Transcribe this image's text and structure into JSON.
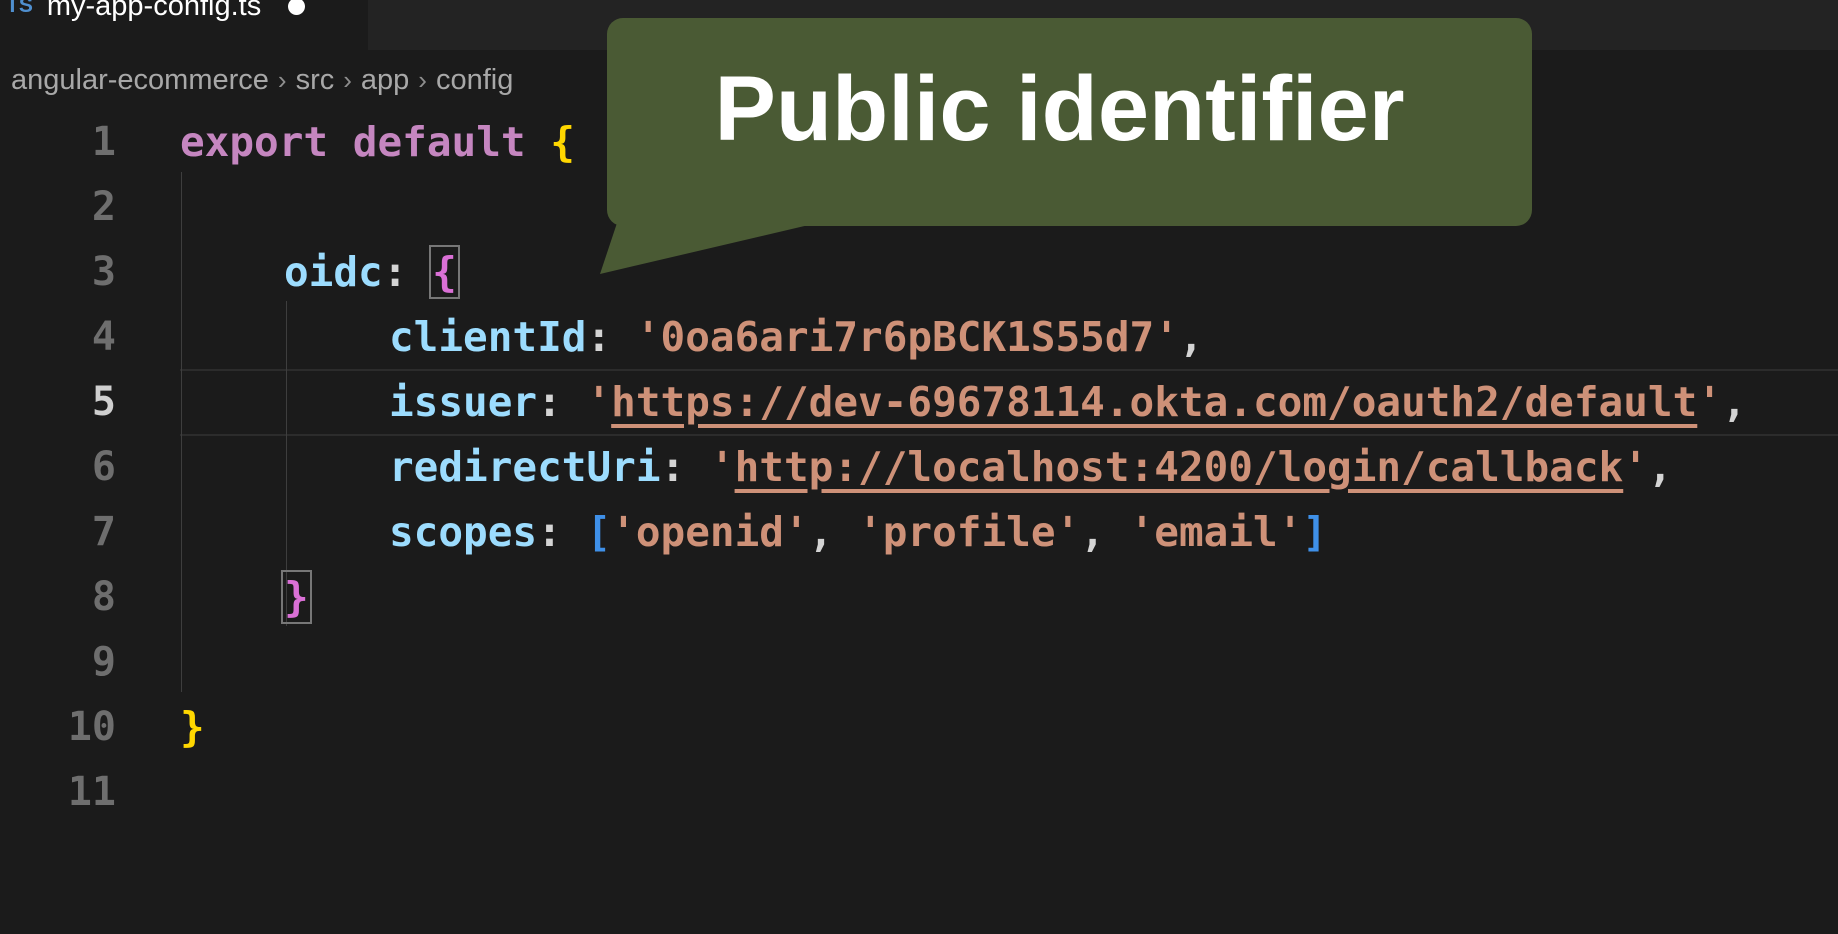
{
  "tab": {
    "lang_badge": "TS",
    "file_name": "my-app-config.ts",
    "dirty": true
  },
  "breadcrumb": [
    "angular-ecommerce",
    "src",
    "app",
    "config"
  ],
  "callout": {
    "text": "Public identifier"
  },
  "editor": {
    "active_line": 5,
    "lines": [
      {
        "n": "1"
      },
      {
        "n": "2"
      },
      {
        "n": "3"
      },
      {
        "n": "4"
      },
      {
        "n": "5"
      },
      {
        "n": "6"
      },
      {
        "n": "7"
      },
      {
        "n": "8"
      },
      {
        "n": "9"
      },
      {
        "n": "10"
      },
      {
        "n": "11"
      }
    ],
    "code": {
      "export_kw": "export",
      "default_kw": "default",
      "open_brace": "{",
      "oidc_key": "oidc",
      "client_id_key": "clientId",
      "client_id_value": "0oa6ari7r6pBCK1S55d7",
      "issuer_key": "issuer",
      "issuer_value": "https://dev-69678114.okta.com/oauth2/default",
      "redirect_key": "redirectUri",
      "redirect_value": "http://localhost:4200/login/callback",
      "scopes_key": "scopes",
      "scopes": [
        "openid",
        "profile",
        "email"
      ],
      "close_brace": "}"
    }
  }
}
